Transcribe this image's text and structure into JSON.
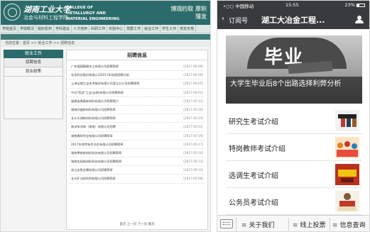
{
  "site": {
    "logo_cn": "湖南工业大学",
    "logo_cn_sub": "冶金与材料工程学院",
    "logo_en": "COLLEGE OF METALLURGY AND MATERIAL ENGINEERING",
    "slogan": "博观约取 厚积薄发",
    "nav": [
      "学院首页",
      "学院概况",
      "组织机构",
      "学科建设",
      "人才培养",
      "科研工作",
      "实验中心",
      "党群工作",
      "就业工作",
      "学生工作",
      "校友天地"
    ],
    "breadcrumb": "当前位置：首页 >> 就业工作 >> 招聘信息",
    "sidebar": {
      "title": "就业工作",
      "items": [
        "招聘信息",
        "就业政策"
      ]
    },
    "main_title": "招聘信息",
    "news": [
      {
        "title": "广东福德精细化工有限公司招聘简章",
        "date": "[2017-06-09]"
      },
      {
        "title": "金发科技股份有限公司2017年校园招聘计划",
        "date": "[2017-06-06]"
      },
      {
        "title": "上海宝钢工业技术服务有限公司湛江分公司招聘简章",
        "date": "[2017-06-05]"
      },
      {
        "title": "中冶\"西部\"工业(云南)有限公司招聘简章",
        "date": "[2017-06-02]"
      },
      {
        "title": "福建省鼎泰新材料有限公司招聘简介",
        "date": "[2017-05-31]"
      },
      {
        "title": "湖南同盛新材料有限公司招聘简章",
        "date": "[2017-05-26]"
      },
      {
        "title": "长沙天湖新材料有限公司招聘简章",
        "date": "[2017-05-24]"
      },
      {
        "title": "株洲市鸿海（湖南）有限公司招聘",
        "date": "[2017-05-22]"
      },
      {
        "title": "湖南春晖铝业有限公司招聘简章",
        "date": "[2017-05-19]"
      },
      {
        "title": "2017年南京有色冶金有限公司招聘简章",
        "date": "[2017-05-17]"
      },
      {
        "title": "湖南粤新新材料科技有限公司招聘简章",
        "date": "[2017-05-16]"
      },
      {
        "title": "湖南金阳新材料科技有限公司招聘简章",
        "date": "[2017-05-12]"
      },
      {
        "title": "浙江宏胜金属有限公司招聘简章",
        "date": "[2017-05-10]"
      },
      {
        "title": "长沙矿冶研究院有限公司招聘简章",
        "date": "[2017-05-08]"
      }
    ],
    "pager": "首页  上一页  下一页  尾页"
  },
  "phone": {
    "status": {
      "carrier": "•○○ 中国移动",
      "time": "15:55",
      "battery": "23%"
    },
    "back_label": "订阅号",
    "title": "湖工大冶金工程...",
    "hero": {
      "art_text": "毕业",
      "caption": "大学生毕业后8个出路选择利弊分析"
    },
    "articles": [
      {
        "label": "研究生考试介绍"
      },
      {
        "label": "特岗教师考试介绍"
      },
      {
        "label": "选调生考试介绍"
      },
      {
        "label": "公务员考试介绍"
      }
    ],
    "menu": [
      "关于我们",
      "线上投票",
      "信息查询"
    ]
  }
}
